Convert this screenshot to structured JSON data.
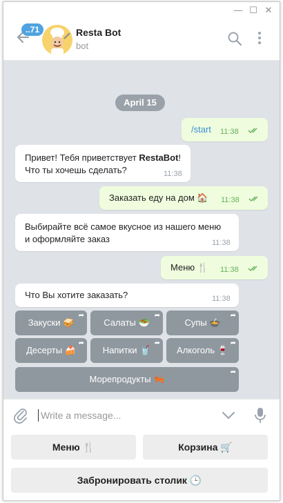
{
  "window": {
    "minimize": "—",
    "maximize": "☐",
    "close": "✕"
  },
  "header": {
    "unread_count": "71",
    "bot_name": "Resta Bot",
    "bot_status": "bot"
  },
  "chat": {
    "date": "April 15",
    "messages": [
      {
        "direction": "out",
        "text": "/start",
        "time": "11:38"
      },
      {
        "direction": "in",
        "line1_prefix": "Привет! Тебя приветствует ",
        "line1_bold": "RestaBot",
        "line1_suffix": "!",
        "line2": "Что ты хочешь сделать?",
        "time": "11:38"
      },
      {
        "direction": "out",
        "text": "Заказать еду на дом 🏠",
        "time": "11:38"
      },
      {
        "direction": "in",
        "line1": "Выбирайте всё самое вкусное из нашего меню",
        "line2": "и оформляйте заказ",
        "time": "11:38"
      },
      {
        "direction": "out",
        "text": "Меню 🍴",
        "time": "11:38"
      },
      {
        "direction": "in",
        "text": "Что Вы хотите заказать?",
        "time": "11:38"
      }
    ],
    "inline_keyboard": [
      [
        "Закуски 🥪",
        "Салаты 🥗",
        "Супы 🍲"
      ],
      [
        "Десерты 🍰",
        "Напитки 🥤",
        "Алкоголь 🍷"
      ],
      [
        "Морепродукты 🦐"
      ]
    ],
    "inline_arrow": "➦"
  },
  "composer": {
    "placeholder": "Write a message..."
  },
  "reply_keyboard": {
    "menu": "Меню 🍴",
    "cart": "Корзина 🛒",
    "reserve": "Забронировать столик 🕒"
  },
  "colors": {
    "chat_background": "#dfe3e8",
    "outgoing_bubble": "#effdde",
    "incoming_bubble": "#ffffff",
    "inline_button": "#8f989f",
    "badge": "#4fa3e0"
  }
}
